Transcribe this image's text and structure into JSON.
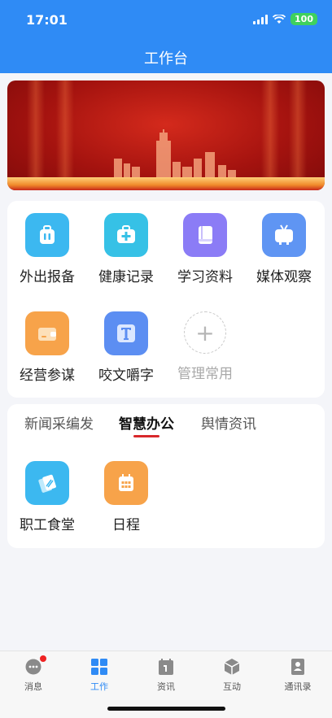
{
  "status": {
    "time": "17:01",
    "battery": "100"
  },
  "header": {
    "title": "工作台"
  },
  "quick_apps": [
    {
      "label": "外出报备",
      "icon": "suitcase-icon",
      "color": "#3cb8f0"
    },
    {
      "label": "健康记录",
      "icon": "medical-kit-icon",
      "color": "#36c1e6"
    },
    {
      "label": "学习资料",
      "icon": "book-icon",
      "color": "#8b7cf6"
    },
    {
      "label": "媒体观察",
      "icon": "tv-icon",
      "color": "#5f95f3"
    },
    {
      "label": "经营参谋",
      "icon": "wallet-icon",
      "color": "#f7a34a"
    },
    {
      "label": "咬文嚼字",
      "icon": "letter-t-icon",
      "color": "#5c8ef2"
    },
    {
      "label": "管理常用",
      "icon": "plus-icon",
      "color": "#b6b6b6"
    }
  ],
  "tabs": [
    {
      "label": "新闻采编发",
      "active": false
    },
    {
      "label": "智慧办公",
      "active": true
    },
    {
      "label": "舆情资讯",
      "active": false
    }
  ],
  "office_apps": [
    {
      "label": "职工食堂",
      "icon": "cards-icon",
      "color": "#3cb8f0"
    },
    {
      "label": "日程",
      "icon": "calendar-icon",
      "color": "#f7a34a"
    }
  ],
  "bottom_nav": [
    {
      "label": "消息",
      "icon": "chat-icon",
      "active": false,
      "badge": true
    },
    {
      "label": "工作",
      "icon": "grid-icon",
      "active": true,
      "badge": false
    },
    {
      "label": "资讯",
      "icon": "calendar-page-icon",
      "active": false,
      "badge": false
    },
    {
      "label": "互动",
      "icon": "cube-icon",
      "active": false,
      "badge": false
    },
    {
      "label": "通讯录",
      "icon": "contacts-icon",
      "active": false,
      "badge": false
    }
  ],
  "colors": {
    "primary": "#2f8bf5",
    "accent_red": "#d8282b",
    "banner_red": "#a5130f"
  }
}
